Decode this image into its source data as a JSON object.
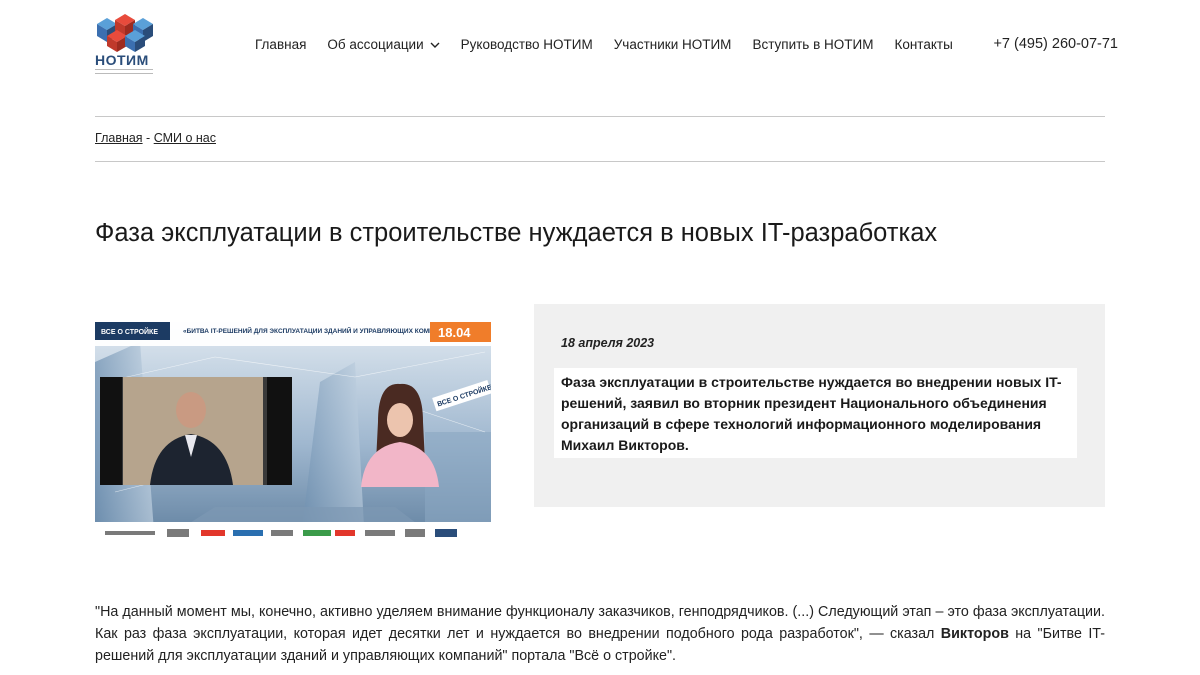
{
  "logo": {
    "text": "НОТИМ"
  },
  "nav": {
    "items": [
      {
        "label": "Главная"
      },
      {
        "label": "Об ассоциации",
        "has_dropdown": true
      },
      {
        "label": "Руководство НОТИМ"
      },
      {
        "label": "Участники НОТИМ"
      },
      {
        "label": "Вступить в НОТИМ"
      },
      {
        "label": "Контакты"
      }
    ],
    "phone": "+7 (495) 260-07-71"
  },
  "breadcrumb": {
    "home": "Главная",
    "separator": " - ",
    "current": "СМИ о нас"
  },
  "article": {
    "title": "Фаза эксплуатации в строительстве нуждается в новых IT-разработках",
    "date": "18 апреля 2023",
    "lead": "Фаза эксплуатации в строительстве нуждается во внедрении новых IT-решений, заявил во вторник президент Национального объединения организаций в сфере технологий информационного моделирования Михаил Викторов.",
    "body_part1": "\"На данный момент мы, конечно, активно уделяем внимание функционалу заказчиков, генподрядчиков. (...) Следующий этап – это фаза эксплуатации. Как раз фаза эксплуатации, которая идет десятки лет и нуждается во внедрении подобного рода разработок\", — сказал ",
    "body_bold": "Викторов",
    "body_part2": " на \"Битве IT-решений для эксплуатации зданий и управляющих компаний\" портала \"Всё о стройке\"."
  },
  "image": {
    "brand": "ВСЕ О СТРОЙКЕ",
    "caption": "«БИТВА IT-РЕШЕНИЙ ДЛЯ ЭКСПЛУАТАЦИИ ЗДАНИЙ И УПРАВЛЯЮЩИХ КОМПАНИЙ»",
    "date_badge": "18.04",
    "studio_sign": "ВСЕ О СТРОЙКЕ"
  },
  "colors": {
    "accent_red": "#e2372b",
    "badge_orange": "#f07d2a",
    "logo_blue": "#2a4d7a",
    "grey_box": "#f0f0f0"
  }
}
